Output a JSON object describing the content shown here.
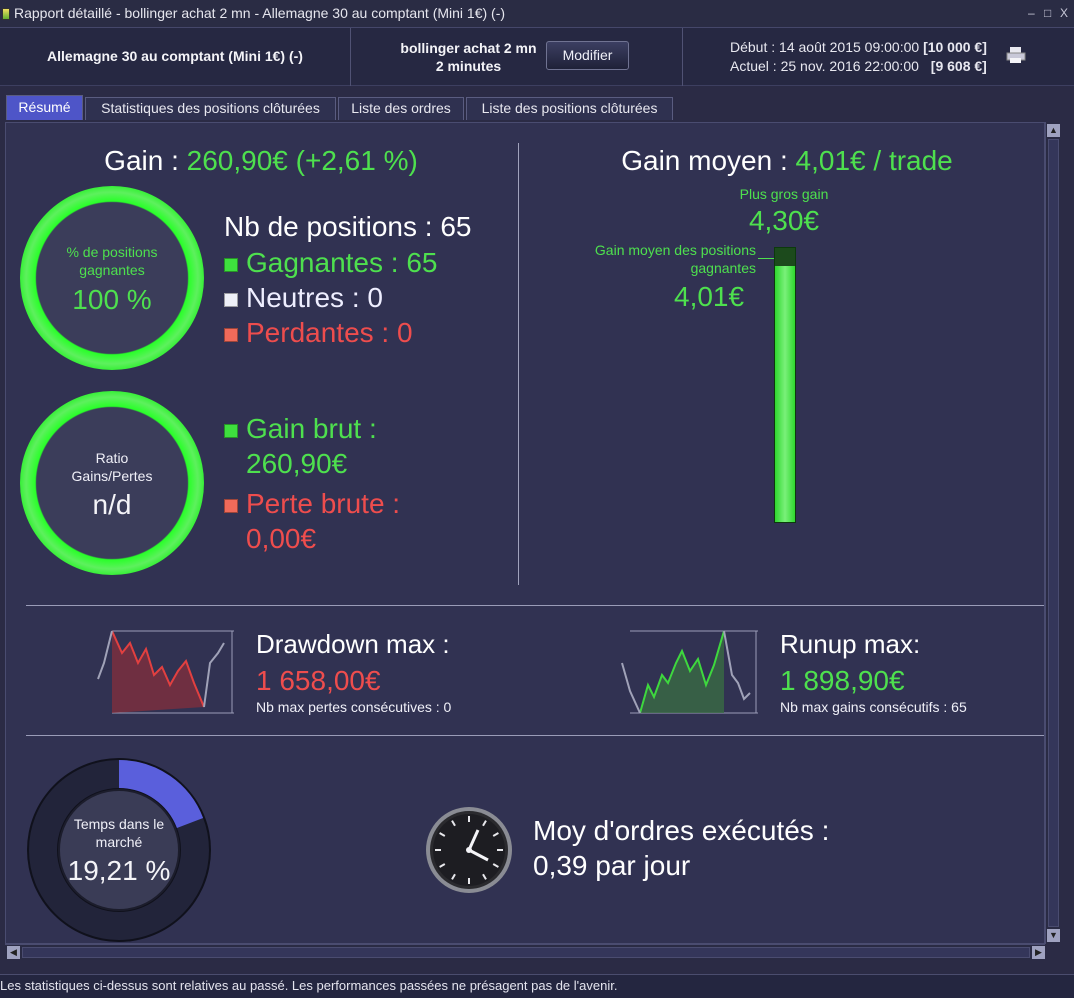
{
  "window": {
    "title": "Rapport détaillé - bollinger achat 2 mn - Allemagne 30 au comptant (Mini 1€) (-)",
    "controls": [
      "–",
      "□",
      "X"
    ]
  },
  "header": {
    "instrument": "Allemagne 30 au comptant (Mini 1€) (-)",
    "strategy": "bollinger achat 2 mn",
    "period": "2 minutes",
    "modify_button": "Modifier",
    "start_label": "Début :",
    "start_date": "14 août 2015 09:00:00",
    "start_value": "[10 000 €]",
    "current_label": "Actuel :",
    "current_date": "25 nov. 2016 22:00:00",
    "current_value": "[9 608 €]",
    "print_icon": "printer-icon"
  },
  "tabs": [
    {
      "label": "Résumé",
      "active": true
    },
    {
      "label": "Statistiques des positions clôturées",
      "active": false
    },
    {
      "label": "Liste des ordres",
      "active": false
    },
    {
      "label": "Liste des positions clôturées",
      "active": false
    }
  ],
  "summary": {
    "gain_label": "Gain :",
    "gain_value": "260,90€ (+2,61 %)",
    "win_ring": {
      "label": "% de positions gagnantes",
      "value": "100 %",
      "fraction": 1.0
    },
    "positions": {
      "total_label": "Nb de positions : 65",
      "winners": "Gagnantes : 65",
      "neutral": "Neutres : 0",
      "losers": "Perdantes : 0"
    },
    "ratio_ring": {
      "label": "Ratio Gains/Pertes",
      "value": "n/d"
    },
    "gross": {
      "gain_label": "Gain brut :",
      "gain_value": "260,90€",
      "loss_label": "Perte brute :",
      "loss_value": "0,00€"
    },
    "avg_gain_label": "Gain moyen :",
    "avg_gain_value": "4,01€ / trade",
    "bar": {
      "max_label": "Plus gros gain",
      "max_value": "4,30€",
      "avg_label": "Gain moyen des positions gagnantes",
      "avg_value": "4,01€",
      "max_num": 4.3,
      "avg_num": 4.01
    },
    "drawdown": {
      "title": "Drawdown max :",
      "value": "1 658,00€",
      "sub": "Nb max pertes consécutives : 0"
    },
    "runup": {
      "title": "Runup max:",
      "value": "1 898,90€",
      "sub": "Nb max gains consécutifs : 65"
    },
    "time_in_market": {
      "label": "Temps dans le marché",
      "value": "19,21 %",
      "fraction": 0.1921
    },
    "orders": {
      "label": "Moy d'ordres exécutés :",
      "value": "0,39 par jour"
    }
  },
  "status": "Les statistiques ci-dessus sont relatives au passé. Les performances passées ne présagent pas de l'avenir.",
  "colors": {
    "green": "#4ee04e",
    "red": "#ee4d4d",
    "accent": "#4e55c8",
    "background": "#313252"
  }
}
